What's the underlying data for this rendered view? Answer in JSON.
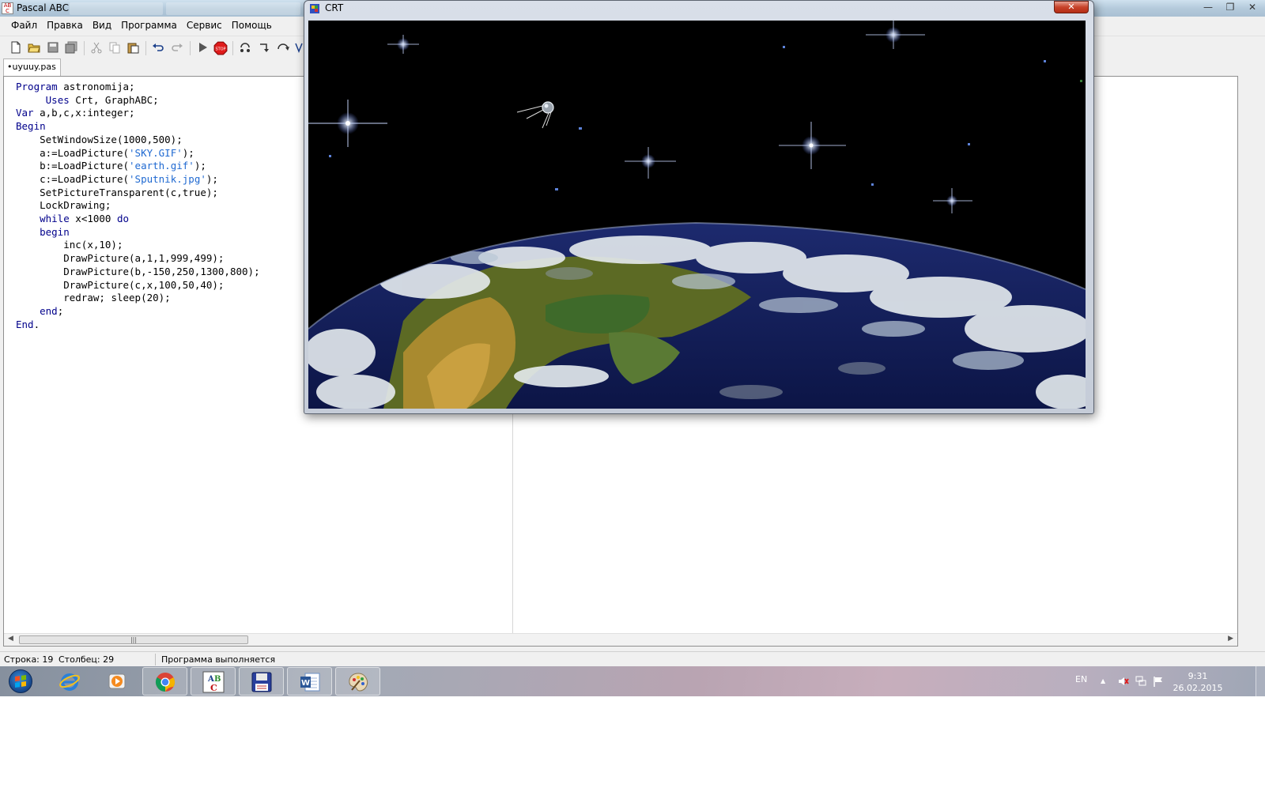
{
  "ide": {
    "title": "Pascal ABC",
    "menu": [
      "Файл",
      "Правка",
      "Вид",
      "Программа",
      "Сервис",
      "Помощь"
    ],
    "file_tab": "•uyuuy.pas",
    "code_lines": [
      "Program astronomija;",
      "     Uses Crt, GraphABC;",
      "Var a,b,c,x:integer;",
      "Begin",
      "    SetWindowSize(1000,500);",
      "    a:=LoadPicture('SKY.GIF');",
      "    b:=LoadPicture('earth.gif');",
      "    c:=LoadPicture('Sputnik.jpg');",
      "    SetPictureTransparent(c,true);",
      "    LockDrawing;",
      "    while x<1000 do",
      "    begin",
      "        inc(x,10);",
      "        DrawPicture(a,1,1,999,499);",
      "        DrawPicture(b,-150,250,1300,800);",
      "        DrawPicture(c,x,100,50,40);",
      "        redraw; sleep(20);",
      "    end;",
      "End."
    ],
    "status": {
      "row": "Строка: 19",
      "col": "Столбец: 29",
      "message": "Программа выполняется"
    }
  },
  "crt": {
    "title": "CRT",
    "close_label": "✕"
  },
  "taskbar": {
    "lang": "EN",
    "time": "9:31",
    "date": "26.02.2015",
    "abc_label": "ABC"
  },
  "colors": {
    "keyword": "#00008b",
    "string": "#1f69d1",
    "space": "#000000"
  }
}
